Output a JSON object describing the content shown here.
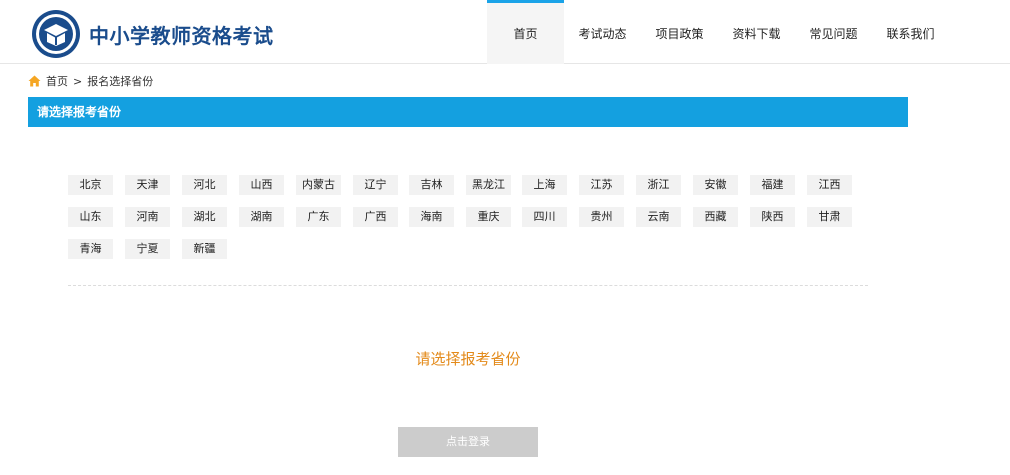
{
  "header": {
    "site_title": "中小学教师资格考试",
    "nav": [
      {
        "label": "首页",
        "active": true
      },
      {
        "label": "考试动态",
        "active": false
      },
      {
        "label": "项目政策",
        "active": false
      },
      {
        "label": "资料下载",
        "active": false
      },
      {
        "label": "常见问题",
        "active": false
      },
      {
        "label": "联系我们",
        "active": false
      }
    ]
  },
  "breadcrumb": {
    "home_icon": "home-icon",
    "home": "首页",
    "separator": ">",
    "current": "报名选择省份"
  },
  "section": {
    "title": "请选择报考省份"
  },
  "provinces": [
    "北京",
    "天津",
    "河北",
    "山西",
    "内蒙古",
    "辽宁",
    "吉林",
    "黑龙江",
    "上海",
    "江苏",
    "浙江",
    "安徽",
    "福建",
    "江西",
    "山东",
    "河南",
    "湖北",
    "湖南",
    "广东",
    "广西",
    "海南",
    "重庆",
    "四川",
    "贵州",
    "云南",
    "西藏",
    "陕西",
    "甘肃",
    "青海",
    "宁夏",
    "新疆"
  ],
  "prompt": "请选择报考省份",
  "login_button": "点击登录",
  "colors": {
    "accent_blue": "#14a0e0",
    "brand_navy": "#1a4c8c",
    "prompt_orange": "#e38a1a",
    "home_icon_orange": "#f5a623",
    "disabled_button": "#cccccc"
  }
}
